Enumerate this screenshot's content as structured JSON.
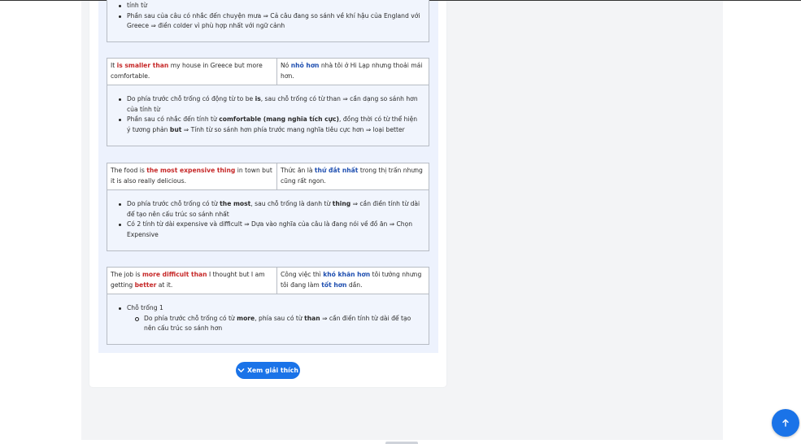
{
  "explanation_blocks": [
    {
      "bullets": [
        {
          "parts": [
            {
              "t": "tính từ",
              "s": ""
            }
          ]
        },
        {
          "parts": [
            {
              "t": "Phần sau của câu có nhắc đến chuyện mưa ⇒ Cả câu đang so sánh về khí hậu của England với Greece ⇒ điền colder vì phù hợp nhất với ngữ cảnh",
              "s": ""
            }
          ]
        }
      ]
    }
  ],
  "items": [
    {
      "english": [
        {
          "t": "It ",
          "s": ""
        },
        {
          "t": "is smaller than",
          "s": "red"
        },
        {
          "t": " my house in Greece but more comfortable.",
          "s": ""
        }
      ],
      "vietnamese": [
        {
          "t": "Nó ",
          "s": ""
        },
        {
          "t": "nhỏ hơn",
          "s": "blue"
        },
        {
          "t": " nhà tôi ở Hi Lạp nhưng thoải mái hơn.",
          "s": ""
        }
      ],
      "bullets": [
        [
          {
            "t": "Do phía trước chỗ trống có động từ to be ",
            "s": ""
          },
          {
            "t": "is",
            "s": "b"
          },
          {
            "t": ", sau chỗ trống có từ than ⇒ cần dạng so sánh hơn của tính từ",
            "s": ""
          }
        ],
        [
          {
            "t": "Phần sau có nhắc đến tính từ ",
            "s": ""
          },
          {
            "t": "comfortable (mang nghĩa tích cực)",
            "s": "b"
          },
          {
            "t": ", đồng thời có từ thể hiện ý tương phản ",
            "s": ""
          },
          {
            "t": "but",
            "s": "b"
          },
          {
            "t": " ⇒ Tính từ so sánh hơn phía trước mang nghĩa tiêu cực hơn ⇒ loại better",
            "s": ""
          }
        ]
      ],
      "sub_bullets": []
    },
    {
      "english": [
        {
          "t": "The food is ",
          "s": ""
        },
        {
          "t": "the most expensive thing",
          "s": "red"
        },
        {
          "t": " in town but it is also really delicious.",
          "s": ""
        }
      ],
      "vietnamese": [
        {
          "t": "Thức ăn là ",
          "s": ""
        },
        {
          "t": "thứ đắt nhất",
          "s": "blue"
        },
        {
          "t": " trong thị trấn nhưng cũng rất ngon.",
          "s": ""
        }
      ],
      "bullets": [
        [
          {
            "t": "Do phía trước chỗ trống có từ ",
            "s": ""
          },
          {
            "t": "the most",
            "s": "b"
          },
          {
            "t": ", sau chỗ trống là danh từ ",
            "s": ""
          },
          {
            "t": "thing",
            "s": "b"
          },
          {
            "t": " ⇒ cần điền tính từ dài để tạo nên cấu trúc so sánh nhất",
            "s": ""
          }
        ],
        [
          {
            "t": "Có 2 tính từ dài expensive và difficult ⇒ Dựa vào nghĩa của câu là đang nói về đồ ăn ⇒ Chọn Expensive",
            "s": ""
          }
        ]
      ],
      "sub_bullets": []
    },
    {
      "english": [
        {
          "t": "The job is ",
          "s": ""
        },
        {
          "t": "more difficult than",
          "s": "red"
        },
        {
          "t": " I thought but I am getting ",
          "s": ""
        },
        {
          "t": "better",
          "s": "red"
        },
        {
          "t": " at it.",
          "s": ""
        }
      ],
      "vietnamese": [
        {
          "t": "Công việc thì ",
          "s": ""
        },
        {
          "t": "khó khăn hơn",
          "s": "blue"
        },
        {
          "t": " tôi tưởng nhưng tôi đang làm ",
          "s": ""
        },
        {
          "t": "tốt hơn",
          "s": "blue"
        },
        {
          "t": " dần.",
          "s": ""
        }
      ],
      "bullets": [
        [
          {
            "t": "Chỗ trống 1",
            "s": ""
          }
        ]
      ],
      "sub_bullets": [
        [
          {
            "t": "Do phía trước chỗ trống có từ ",
            "s": ""
          },
          {
            "t": "more",
            "s": "b"
          },
          {
            "t": ", phía sau có từ ",
            "s": ""
          },
          {
            "t": "than",
            "s": "b"
          },
          {
            "t": " ⇒ cần điền tính từ dài để tạo nên cấu trúc so sánh hơn",
            "s": ""
          }
        ]
      ]
    }
  ],
  "toggle_button": {
    "label": "Xem giải thích",
    "icon": "chevron-down-icon"
  },
  "scroll_top_button": {
    "icon": "arrow-up-icon"
  },
  "colors": {
    "accent": "#1a73e8",
    "highlight_en": "#c62828",
    "highlight_vi": "#1f4fb0",
    "panel": "#edf2fd"
  }
}
